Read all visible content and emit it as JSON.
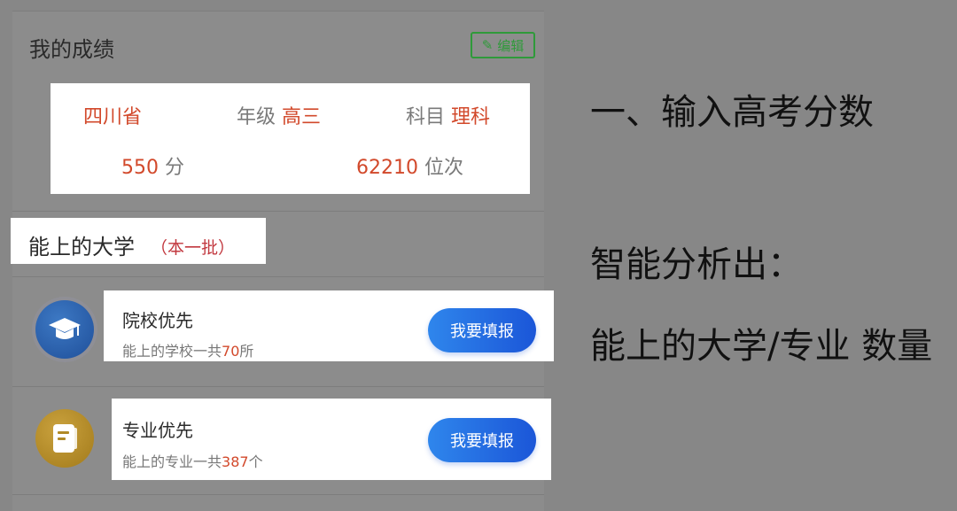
{
  "my_scores": {
    "title": "我的成绩",
    "edit_label": "编辑",
    "province": "四川省",
    "grade_label": "年级",
    "grade_value": "高三",
    "subject_label": "科目",
    "subject_value": "理科",
    "score_value": "550",
    "score_unit": "分",
    "rank_value": "62210",
    "rank_unit": "位次"
  },
  "universities": {
    "title": "能上的大学",
    "batch": "（本一批）"
  },
  "options": [
    {
      "title": "院校优先",
      "desc_prefix": "能上的学校一共",
      "count": "70",
      "desc_suffix": "所",
      "button": "我要填报",
      "icon": "graduation-cap-icon"
    },
    {
      "title": "专业优先",
      "desc_prefix": "能上的专业一共",
      "count": "387",
      "desc_suffix": "个",
      "button": "我要填报",
      "icon": "book-icon"
    }
  ],
  "annotations": {
    "step1": "一、输入高考分数",
    "step2": "智能分析出：",
    "step3": "能上的大学/专业 数量"
  },
  "colors": {
    "accent_red": "#d2492b",
    "button_blue": "#1b56d8",
    "edit_green": "#2f9a3a"
  }
}
